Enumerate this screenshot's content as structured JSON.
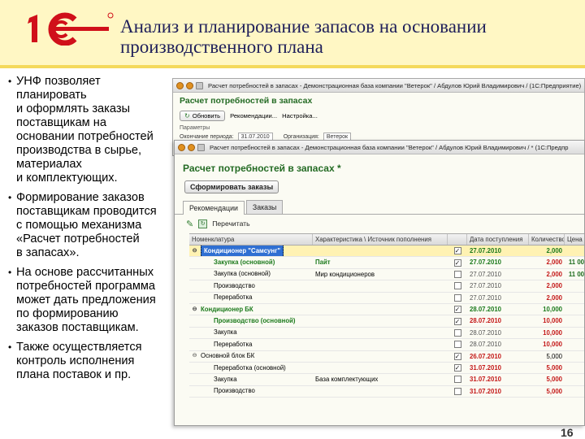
{
  "slide": {
    "title": "Анализ и планирование запасов на основании производственного плана",
    "page_number": "16",
    "bullets": [
      "УНФ позволяет\nпланировать\nи оформлять заказы\nпоставщикам на\nосновании потребностей\nпроизводства в сырье,\nматериалах\nи комплектующих.",
      "Формирование заказов\nпоставщикам проводится\nс помощью механизма\n«Расчет потребностей\nв запасах».",
      "На основе рассчитанных\nпотребностей программа\nможет дать предложения\nпо формированию\nзаказов поставщикам.",
      "Также осуществляется\nконтроль исполнения\nплана поставок и пр."
    ]
  },
  "colors": {
    "header_band": "#fff7c4",
    "logo_red": "#d0101a",
    "heading_green": "#246b24",
    "value_green": "#1c7a1c",
    "value_red": "#c41818",
    "selection_blue": "#2f6fd2"
  },
  "back_window": {
    "title": "Расчет потребностей в запасах - Демонстрационная база компании \"Ветерок\" / Абдулов Юрий Владимирович / (1С:Предприятие)",
    "heading": "Расчет потребностей в запасах",
    "refresh_label": "Обновить",
    "recommendations_label": "Рекомендации...",
    "settings_label": "Настройка...",
    "params_label": "Параметры",
    "period_label": "Окончание периода:",
    "period_value": "31.07.2010",
    "org_label": "Организация:",
    "org_value": "Ветерок"
  },
  "front_window": {
    "title": "Расчет потребностей в запасах - Демонстрационная база компании \"Ветерок\" / Абдулов Юрий Владимирович / * (1С:Предпр",
    "heading": "Расчет потребностей в запасах *",
    "form_orders_label": "Сформировать заказы",
    "tabs": [
      "Рекомендации",
      "Заказы"
    ],
    "recalc_label": "Перечитать",
    "columns": [
      "Номенклатура",
      "Характеристика \\ Источник пополнения",
      "",
      "Дата поступления",
      "Количество",
      "Цена"
    ],
    "rows": [
      {
        "name": "Кондиционер \"Самсунг\"",
        "char": "",
        "checked": "✓",
        "date": "27.07.2010",
        "qty": "2,000",
        "price": ""
      },
      {
        "name": "Закупка (основной)",
        "char": "Пайт",
        "checked": "✓",
        "date": "27.07.2010",
        "qty": "2,000",
        "price": "11 00"
      },
      {
        "name": "Закупка (основной)",
        "char": "Мир кондиционеров",
        "checked": "",
        "date": "27.07.2010",
        "qty": "2,000",
        "price": "11 00"
      },
      {
        "name": "Производство",
        "char": "",
        "checked": "",
        "date": "27.07.2010",
        "qty": "2,000",
        "price": ""
      },
      {
        "name": "Переработка",
        "char": "",
        "checked": "",
        "date": "27.07.2010",
        "qty": "2,000",
        "price": ""
      },
      {
        "name": "Кондиционер БК",
        "char": "",
        "checked": "✓",
        "date": "28.07.2010",
        "qty": "10,000",
        "price": ""
      },
      {
        "name": "Производство (основной)",
        "char": "",
        "checked": "✓",
        "date": "28.07.2010",
        "qty": "10,000",
        "price": ""
      },
      {
        "name": "Закупка",
        "char": "",
        "checked": "",
        "date": "28.07.2010",
        "qty": "10,000",
        "price": ""
      },
      {
        "name": "Переработка",
        "char": "",
        "checked": "",
        "date": "28.07.2010",
        "qty": "10,000",
        "price": ""
      },
      {
        "name": "Основной блок БК",
        "char": "",
        "checked": "✓",
        "date": "26.07.2010",
        "qty": "5,000",
        "price": ""
      },
      {
        "name": "Переработка (основной)",
        "char": "",
        "checked": "✓",
        "date": "31.07.2010",
        "qty": "5,000",
        "price": ""
      },
      {
        "name": "Закупка",
        "char": "База комплектующих",
        "checked": "",
        "date": "31.07.2010",
        "qty": "5,000",
        "price": ""
      },
      {
        "name": "Производство",
        "char": "",
        "checked": "",
        "date": "31.07.2010",
        "qty": "5,000",
        "price": ""
      }
    ]
  }
}
